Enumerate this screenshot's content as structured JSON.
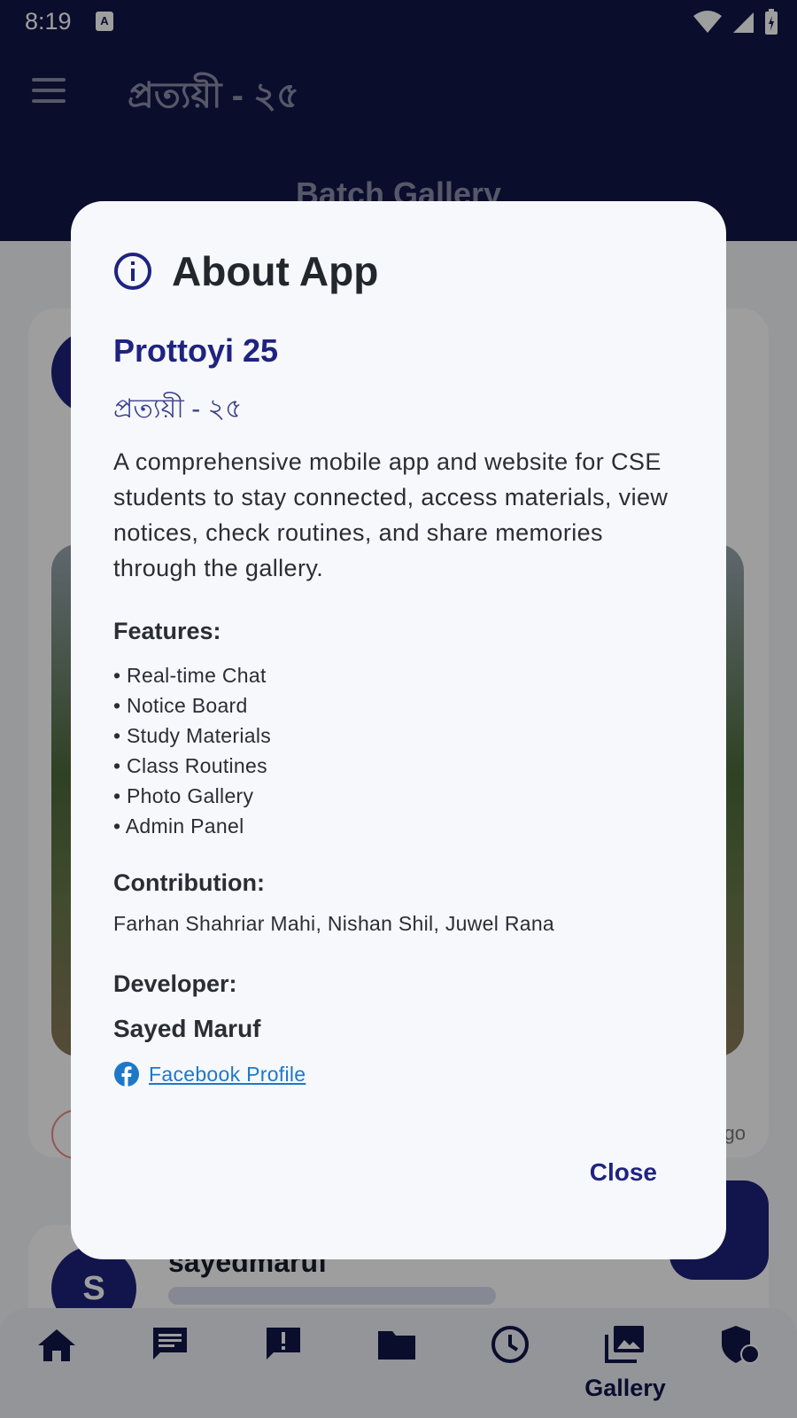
{
  "status_bar": {
    "time": "8:19",
    "notification_icon": "A"
  },
  "app_bar": {
    "title": "প্রত্যয়ী - ২৫",
    "page_heading": "Batch Gallery"
  },
  "background": {
    "post_ago_fragment": "go",
    "second_post_user": "sayedmaruf",
    "second_post_avatar_letter": "S"
  },
  "bottom_nav": {
    "items": [
      {
        "icon": "home-icon"
      },
      {
        "icon": "chat-icon"
      },
      {
        "icon": "notice-icon"
      },
      {
        "icon": "folder-icon"
      },
      {
        "icon": "clock-icon"
      },
      {
        "icon": "gallery-icon",
        "label": "Gallery",
        "active": true
      },
      {
        "icon": "admin-shield-icon"
      }
    ]
  },
  "dialog": {
    "title": "About App",
    "app_name": "Prottoyi 25",
    "app_name_bn": "প্রত্যয়ী - ২৫",
    "description": "A comprehensive mobile app and website for CSE students to stay connected, access materials, view notices, check routines, and share memories through the gallery.",
    "features_title": "Features:",
    "features": [
      "• Real-time Chat",
      "• Notice Board",
      "• Study Materials",
      "• Class Routines",
      "• Photo Gallery",
      "• Admin Panel"
    ],
    "contribution_title": "Contribution:",
    "contribution": "Farhan Shahriar Mahi, Nishan Shil, Juwel Rana",
    "developer_title": "Developer:",
    "developer_name": "Sayed Maruf",
    "facebook_link": "Facebook Profile",
    "close_label": "Close"
  },
  "colors": {
    "primary": "#111548",
    "accent": "#1f2380",
    "link": "#1e78c8",
    "dialog_bg": "#f7f8fb"
  }
}
